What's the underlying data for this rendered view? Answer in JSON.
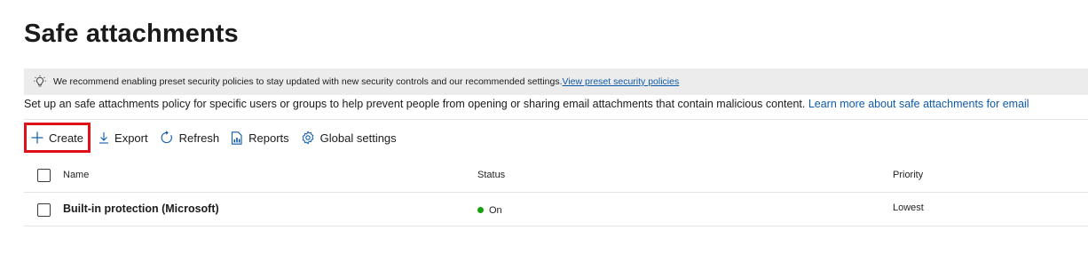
{
  "page": {
    "title": "Safe attachments"
  },
  "banner": {
    "icon": "lightbulb-icon",
    "text": "We recommend enabling preset security policies to stay updated with new security controls and our recommended settings.",
    "link": "View preset security policies"
  },
  "description": {
    "text": "Set up an safe attachments policy for specific users or groups to help prevent people from opening or sharing email attachments that contain malicious content. ",
    "link": "Learn more about safe attachments for email"
  },
  "toolbar": {
    "create_label": "Create",
    "export_label": "Export",
    "refresh_label": "Refresh",
    "reports_label": "Reports",
    "global_settings_label": "Global settings"
  },
  "table": {
    "columns": {
      "name": "Name",
      "status": "Status",
      "priority": "Priority"
    },
    "rows": [
      {
        "name": "Built-in protection (Microsoft)",
        "status": "On",
        "priority": "Lowest"
      }
    ]
  },
  "colors": {
    "link": "#0f5aa8",
    "highlight_border": "#e0101a",
    "status_on": "#13a10e",
    "banner_bg": "#ececec"
  }
}
